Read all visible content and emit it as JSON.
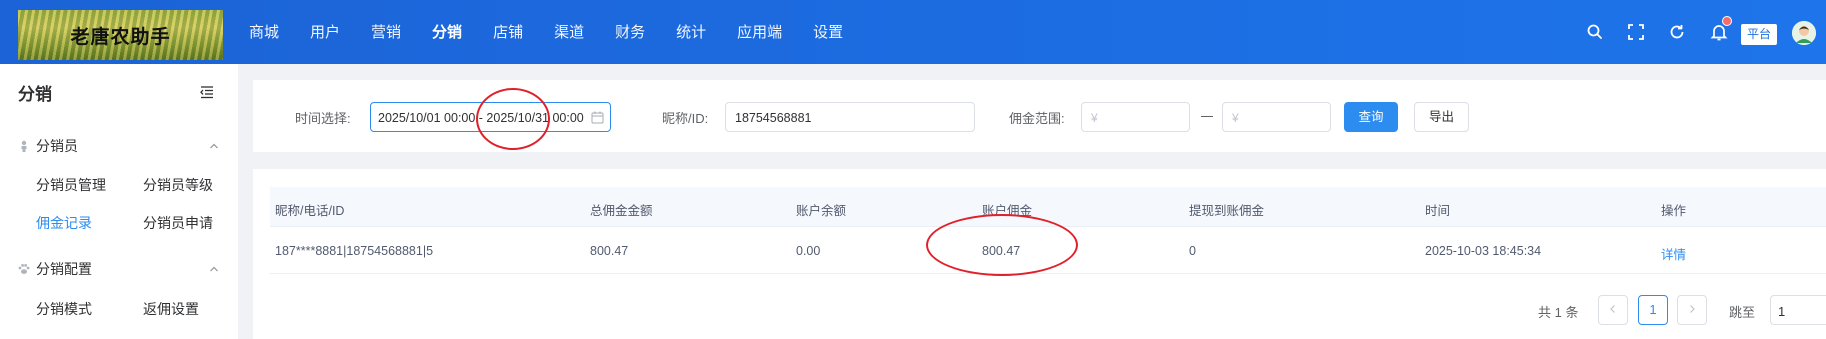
{
  "header": {
    "logo_text": "老唐农助手",
    "nav": [
      {
        "label": "商城"
      },
      {
        "label": "用户"
      },
      {
        "label": "营销"
      },
      {
        "label": "分销",
        "active": true
      },
      {
        "label": "店铺"
      },
      {
        "label": "渠道"
      },
      {
        "label": "财务"
      },
      {
        "label": "统计"
      },
      {
        "label": "应用端"
      },
      {
        "label": "设置"
      }
    ],
    "icons": [
      "search-icon",
      "fullscreen-icon",
      "refresh-icon",
      "bell-icon",
      "avatar"
    ],
    "platform_tag": "平台",
    "colors": {
      "bar": "#1d6fe0",
      "accent": "#2d8cf0",
      "badge": "#f56c6c"
    }
  },
  "sidebar": {
    "title": "分销",
    "groups": [
      {
        "label": "分销员",
        "icon": "person-icon",
        "items": [
          "分销员管理",
          "分销员等级",
          "佣金记录",
          "分销员申请"
        ],
        "active": "佣金记录"
      },
      {
        "label": "分销配置",
        "icon": "paw-icon",
        "items": [
          "分销模式",
          "返佣设置"
        ]
      }
    ]
  },
  "filters": {
    "time_label": "时间选择:",
    "time_value": "2025/10/01 00:00 - 2025/10/31 00:00",
    "nickname_label": "昵称/ID:",
    "nickname_value": "18754568881",
    "commission_label": "佣金范围:",
    "min_placeholder": "¥",
    "max_placeholder": "¥",
    "search_button": "查询",
    "export_button": "导出"
  },
  "table": {
    "columns": [
      "昵称/电话/ID",
      "总佣金金额",
      "账户余额",
      "账户佣金",
      "提现到账佣金",
      "时间",
      "操作"
    ],
    "rows": [
      {
        "user": "187****8881|18754568881|5",
        "total": "800.47",
        "balance": "0.00",
        "commission": "800.47",
        "withdrawn": "0",
        "time": "2025-10-03 18:45:34",
        "action": "详情"
      }
    ]
  },
  "pagination": {
    "total_text": "共 1 条",
    "current": "1",
    "jump_label": "跳至",
    "jump_value": "1"
  }
}
